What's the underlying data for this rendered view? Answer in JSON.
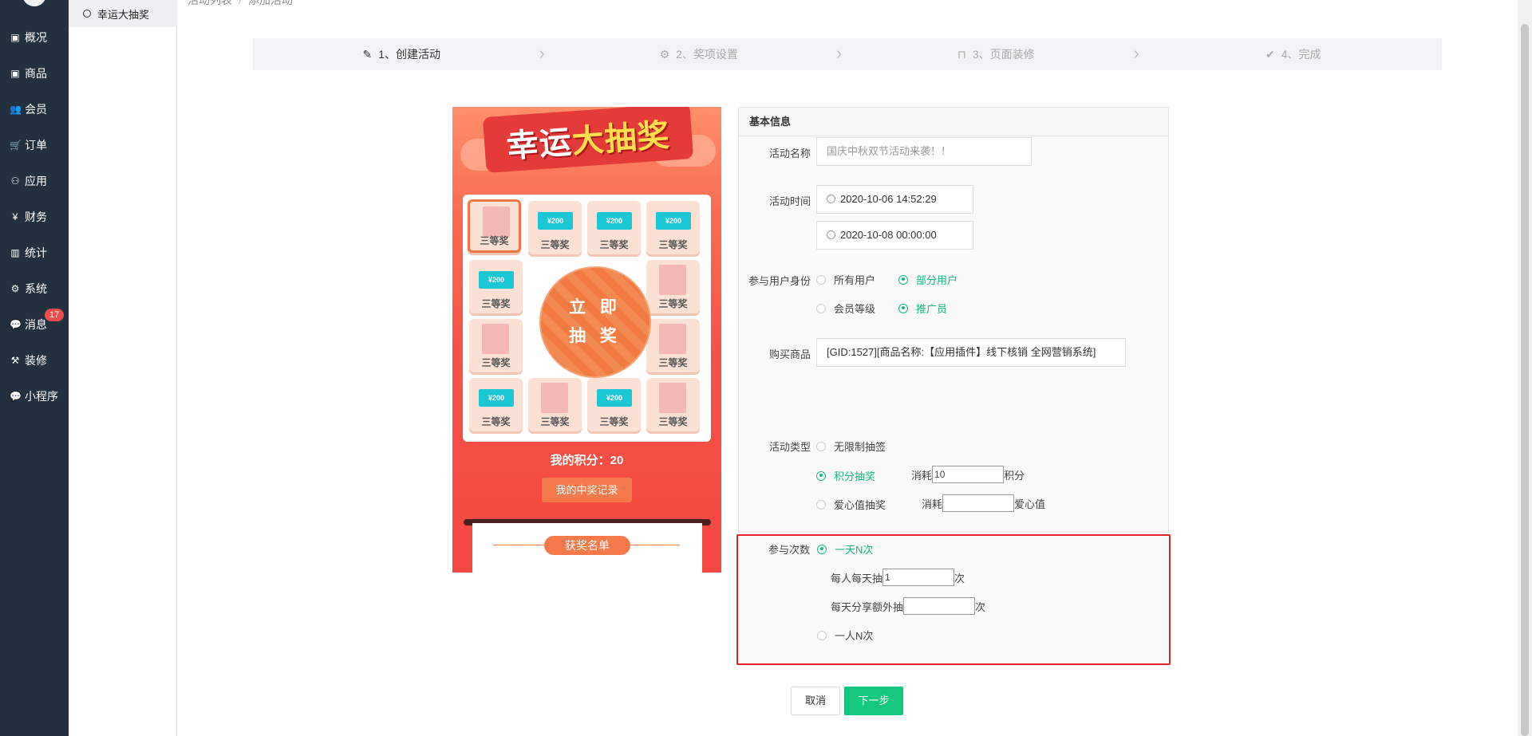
{
  "sidebar": {
    "items": [
      {
        "label": "概况",
        "icon": "dashboard-icon"
      },
      {
        "label": "商品",
        "icon": "goods-icon"
      },
      {
        "label": "会员",
        "icon": "users-icon"
      },
      {
        "label": "订单",
        "icon": "cart-icon"
      },
      {
        "label": "应用",
        "icon": "apps-icon"
      },
      {
        "label": "财务",
        "icon": "yen-icon"
      },
      {
        "label": "统计",
        "icon": "chart-icon"
      },
      {
        "label": "系统",
        "icon": "gear-icon"
      },
      {
        "label": "消息",
        "icon": "chat-icon"
      },
      {
        "label": "装修",
        "icon": "hammer-icon"
      },
      {
        "label": "小程序",
        "icon": "wechat-icon"
      }
    ],
    "message_badge": "17"
  },
  "subsidebar": {
    "active_item": "幸运大抽奖"
  },
  "breadcrumb": {
    "items": [
      "活动列表",
      "添加活动"
    ],
    "separator": "/"
  },
  "steps": [
    {
      "label": "1、创建活动",
      "icon": "edit-icon",
      "active": true
    },
    {
      "label": "2、奖项设置",
      "icon": "settings-icon",
      "active": false
    },
    {
      "label": "3、页面装修",
      "icon": "bag-icon",
      "active": false
    },
    {
      "label": "4、完成",
      "icon": "check-circle-icon",
      "active": false
    }
  ],
  "preview": {
    "title_part1": "幸运",
    "title_part2": "大抽奖",
    "prize_label": "三等奖",
    "ticket_text": "¥200",
    "spin_line1": "立 即",
    "spin_line2": "抽 奖",
    "points_text": "我的积分：20",
    "record_button": "我的中奖记录",
    "winners_title": "获奖名单"
  },
  "form": {
    "section_title": "基本信息",
    "name_label": "活动名称",
    "name_placeholder": "国庆中秋双节活动来袭！！",
    "time_label": "活动时间",
    "time_start": "2020-10-06 14:52:29",
    "time_end": "2020-10-08 00:00:00",
    "identity_label": "参与用户身份",
    "identity_options": [
      "所有用户",
      "部分用户",
      "会员等级",
      "推广员"
    ],
    "goods_label": "购买商品",
    "goods_value": "[GID:1527][商品名称:【应用插件】线下核销 全网营销系统]",
    "type_label": "活动类型",
    "type_options": [
      "无限制抽签",
      "积分抽奖",
      "爱心值抽奖"
    ],
    "consume_label": "消耗",
    "points_unit": "积分",
    "points_value": "10",
    "love_unit": "爱心值",
    "times_label": "参与次数",
    "times_options": [
      "一天N次",
      "一人N次"
    ],
    "daily_label": "每人每天抽",
    "daily_value": "1",
    "times_unit": "次",
    "share_label": "每天分享额外抽"
  },
  "buttons": {
    "cancel": "取消",
    "next": "下一步"
  },
  "colors": {
    "accent": "#14b77d",
    "sidebar": "#233040",
    "highlight_border": "#e02424"
  }
}
